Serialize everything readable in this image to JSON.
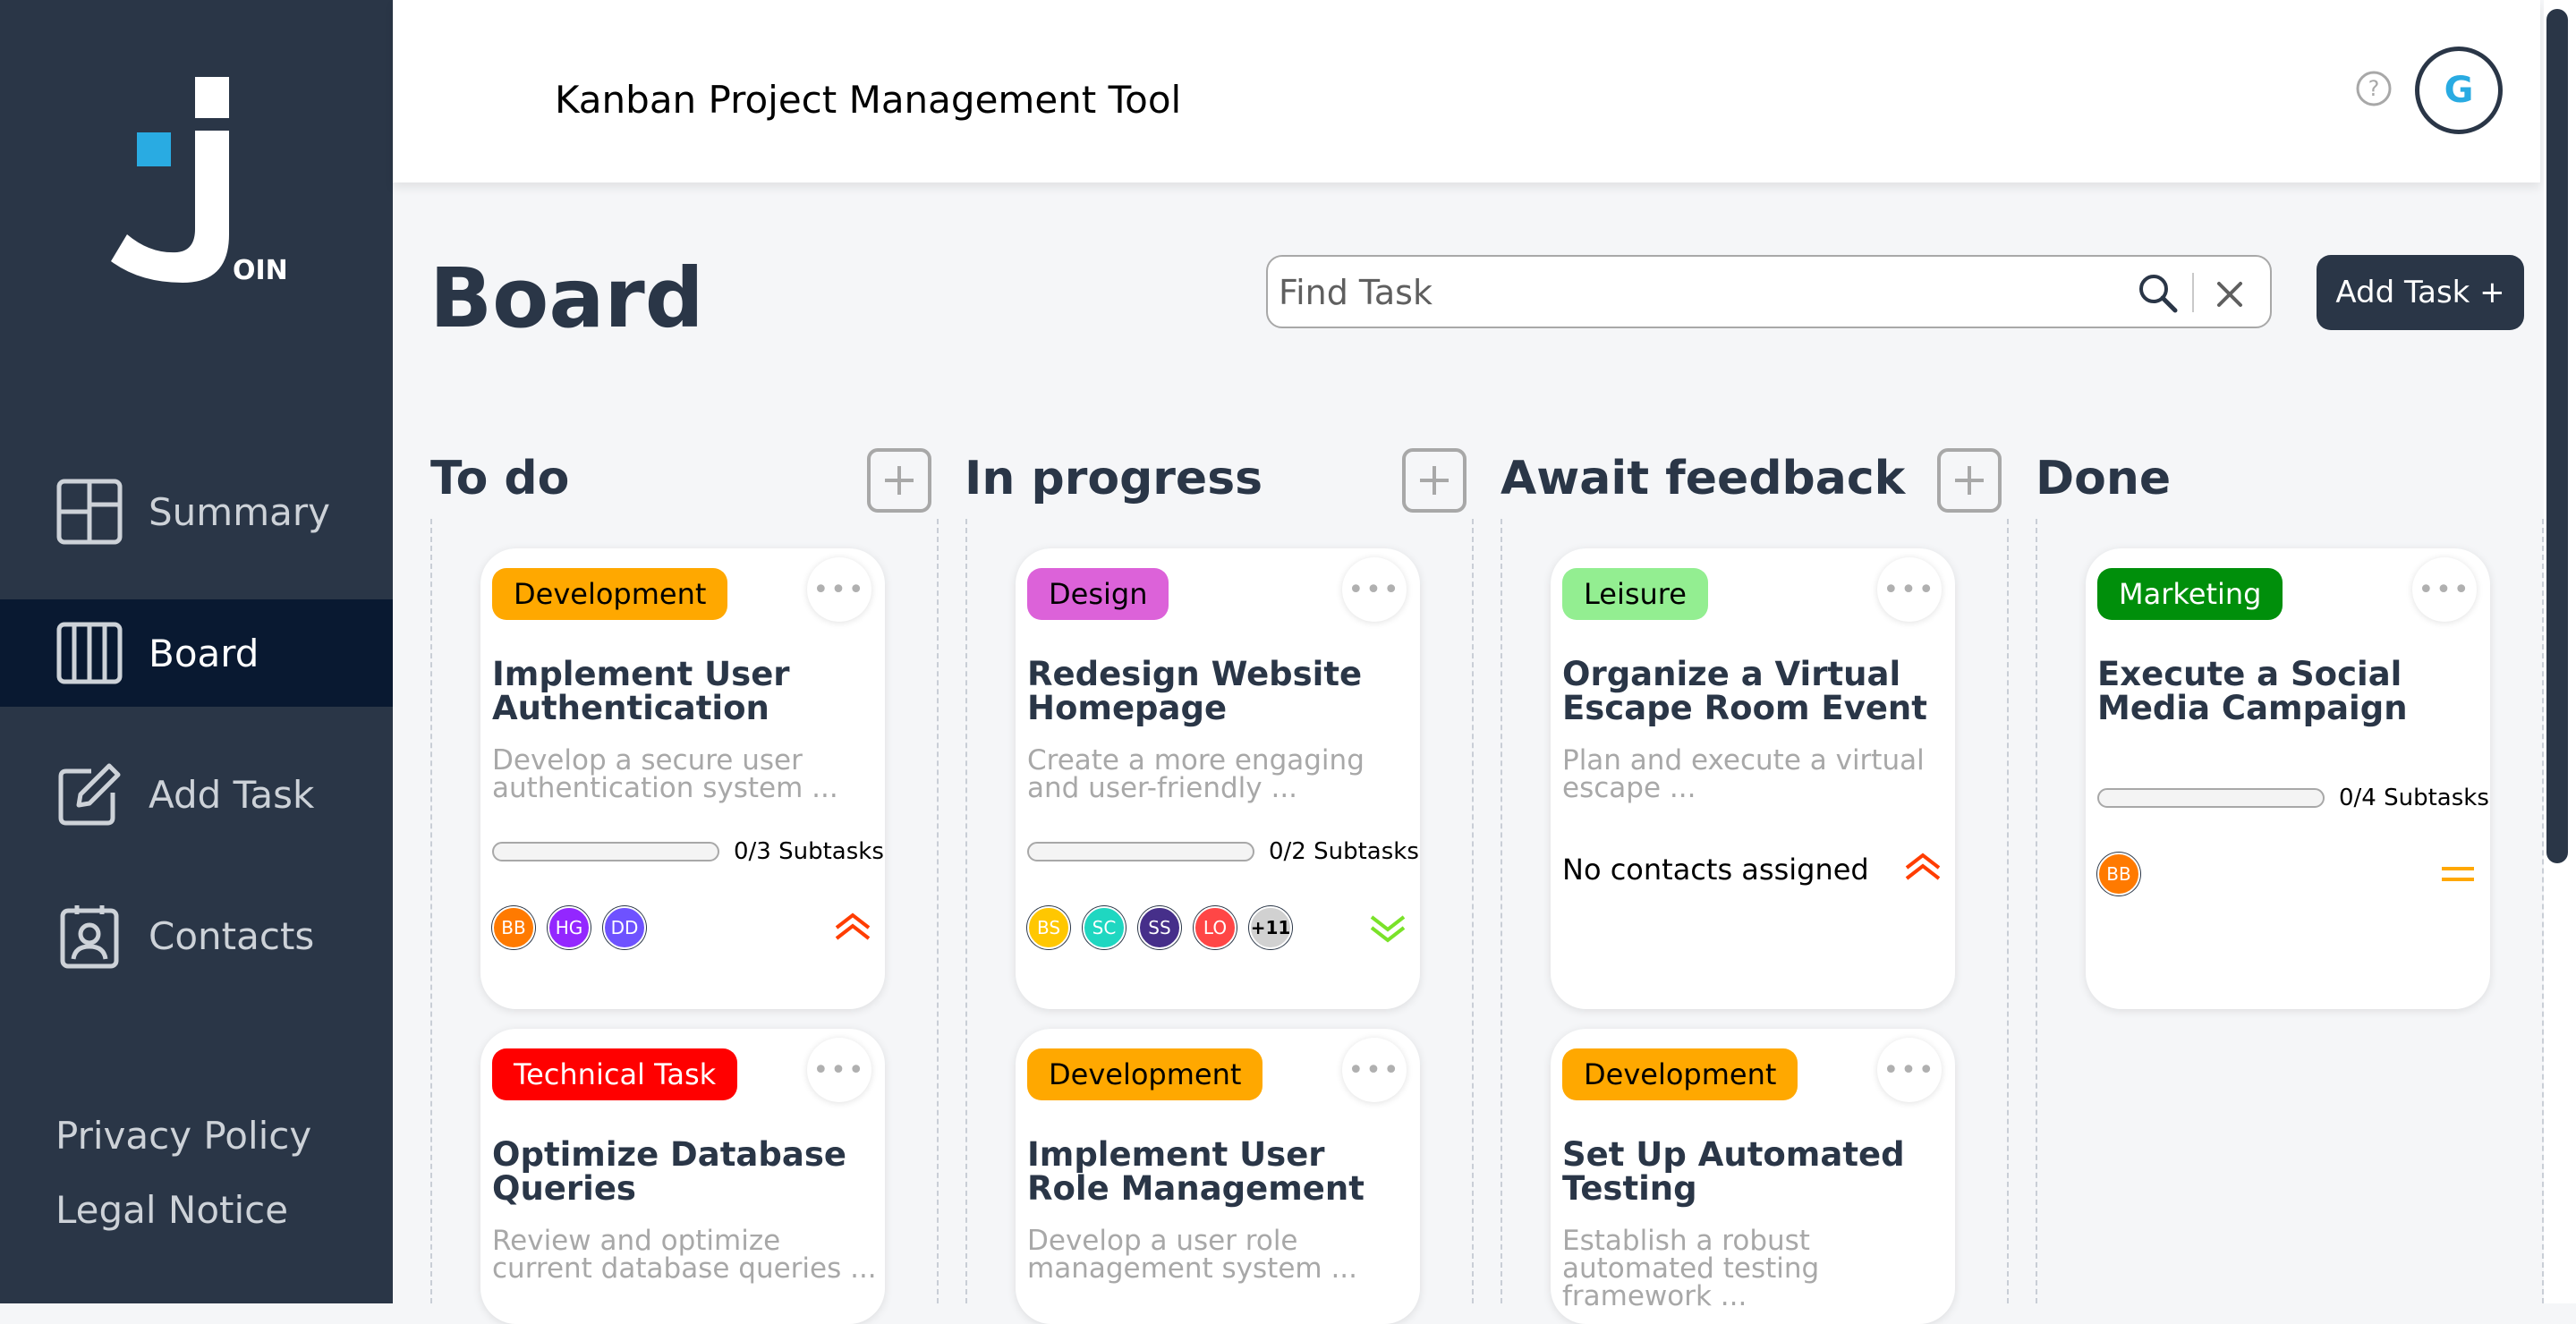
{
  "app": {
    "title": "Kanban Project Management Tool",
    "user_initial": "G",
    "logo_text": "OIN"
  },
  "sidebar": {
    "items": [
      {
        "label": "Summary",
        "icon": "summary-icon"
      },
      {
        "label": "Board",
        "icon": "board-icon",
        "active": true
      },
      {
        "label": "Add Task",
        "icon": "edit-icon"
      },
      {
        "label": "Contacts",
        "icon": "contacts-icon"
      }
    ],
    "footer": {
      "privacy": "Privacy Policy",
      "legal": "Legal Notice"
    }
  },
  "board": {
    "title": "Board",
    "search_placeholder": "Find Task",
    "add_task_label": "Add Task +"
  },
  "columns": [
    {
      "title": "To do",
      "cards": [
        {
          "category": "Development",
          "cat_color": "#ffa800",
          "cat_text": "#000000",
          "title": "Implement User Authentication",
          "desc": "Develop a secure user authentication system ...",
          "subtasks_done": 0,
          "subtasks_total": 3,
          "subtasks_text": "0/3 Subtasks",
          "avatars": [
            {
              "initials": "BB",
              "color": "#ff7a00"
            },
            {
              "initials": "HG",
              "color": "#9327ff"
            },
            {
              "initials": "DD",
              "color": "#6e52ff"
            }
          ],
          "priority": "urgent"
        },
        {
          "category": "Technical Task",
          "cat_color": "#ff0000",
          "cat_text": "#ffffff",
          "title": "Optimize Database Queries",
          "desc": "Review and optimize current database queries ..."
        }
      ]
    },
    {
      "title": "In progress",
      "cards": [
        {
          "category": "Design",
          "cat_color": "#dc62d9",
          "cat_text": "#000000",
          "title": "Redesign Website Homepage",
          "desc": "Create a more engaging and user-friendly ...",
          "subtasks_done": 0,
          "subtasks_total": 2,
          "subtasks_text": "0/2 Subtasks",
          "avatars": [
            {
              "initials": "BS",
              "color": "#ffc701"
            },
            {
              "initials": "SC",
              "color": "#1fd7c1"
            },
            {
              "initials": "SS",
              "color": "#462f8a"
            },
            {
              "initials": "LO",
              "color": "#ff4646"
            },
            {
              "initials": "+11",
              "color": "#d1d1d1"
            }
          ],
          "priority": "low"
        },
        {
          "category": "Development",
          "cat_color": "#ffa800",
          "cat_text": "#000000",
          "title": "Implement User Role Management",
          "desc": "Develop a user role management system ..."
        }
      ]
    },
    {
      "title": "Await feedback",
      "cards": [
        {
          "category": "Leisure",
          "cat_color": "#93ee91",
          "cat_text": "#000000",
          "title": "Organize a Virtual Escape Room Event",
          "desc": "Plan and execute a virtual escape ...",
          "no_contacts": "No contacts assigned",
          "priority": "urgent"
        },
        {
          "category": "Development",
          "cat_color": "#ffa800",
          "cat_text": "#000000",
          "title": "Set Up Automated Testing",
          "desc": "Establish a robust automated testing framework ..."
        }
      ]
    },
    {
      "title": "Done",
      "cards": [
        {
          "category": "Marketing",
          "cat_color": "#008f0b",
          "cat_text": "#ffffff",
          "title": "Execute a Social Media Campaign",
          "desc": "",
          "subtasks_done": 0,
          "subtasks_total": 4,
          "subtasks_text": "0/4 Subtasks",
          "avatars": [
            {
              "initials": "BB",
              "color": "#ff7a00"
            }
          ],
          "priority": "medium"
        }
      ]
    }
  ],
  "colors": {
    "sidebar": "#2a3647",
    "active_nav": "#091931",
    "accent": "#29abe2",
    "urgent": "#ff3d00",
    "medium": "#ffa800",
    "low": "#7ae229"
  }
}
